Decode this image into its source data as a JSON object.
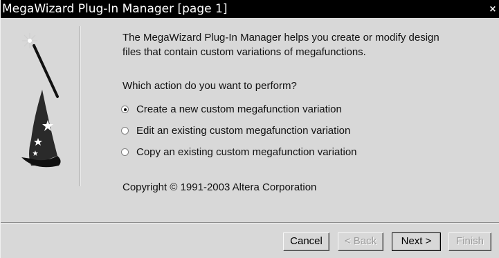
{
  "window": {
    "title": "MegaWizard Plug-In Manager [page 1]",
    "close_glyph": "×"
  },
  "content": {
    "intro_line1": "The MegaWizard Plug-In Manager helps you create or modify design",
    "intro_line2": "files that contain custom variations of megafunctions.",
    "question": "Which action do you want to perform?",
    "options": [
      {
        "label": "Create a new custom megafunction variation",
        "selected": true
      },
      {
        "label": "Edit an existing custom megafunction variation",
        "selected": false
      },
      {
        "label": "Copy an existing custom megafunction variation",
        "selected": false
      }
    ],
    "copyright": "Copyright © 1991-2003 Altera Corporation"
  },
  "buttons": {
    "cancel": {
      "label": "Cancel",
      "enabled": true
    },
    "back": {
      "label": "< Back",
      "enabled": false
    },
    "next": {
      "label": "Next >",
      "enabled": true
    },
    "finish": {
      "label": "Finish",
      "enabled": false
    }
  },
  "icons": {
    "wizard_art": "wizard-hat-and-wand-icon"
  }
}
